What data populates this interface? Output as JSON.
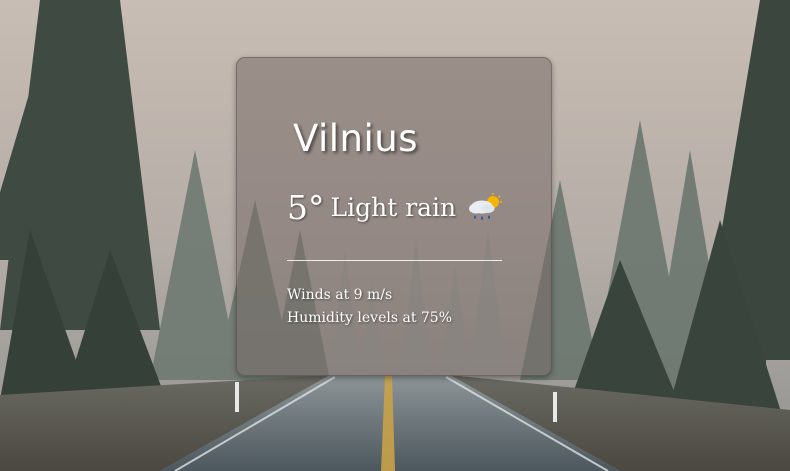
{
  "weather": {
    "city": "Vilnius",
    "temperature": "5°",
    "condition": "Light rain",
    "condition_icon": "light-rain-icon",
    "wind": "Winds at 9 m/s",
    "humidity": "Humidity levels at 75%"
  },
  "colors": {
    "card_background": "#786c68",
    "text": "#ffffff",
    "sky": "#c9bfb7",
    "road": "#5b6469"
  }
}
